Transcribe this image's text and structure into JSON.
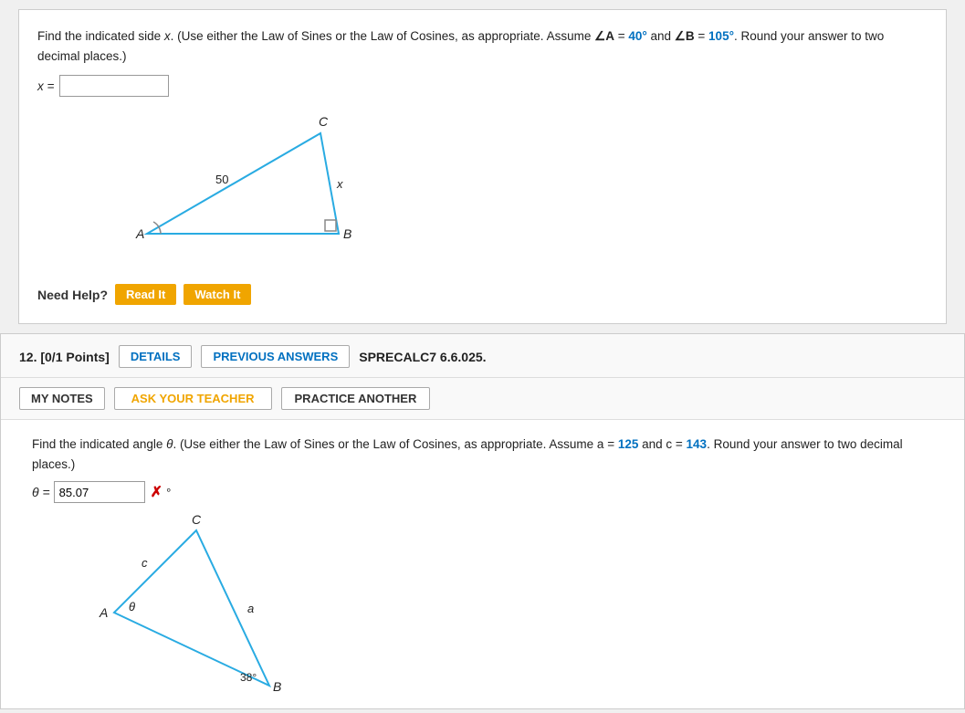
{
  "problem11": {
    "text_part1": "Find the indicated side ",
    "variable_x": "x",
    "text_part2": ". (Use either the Law of Sines or the Law of Cosines, as appropriate. Assume ",
    "angle_a_label": "∠A",
    "angle_a_val": "40°",
    "text_and": " and ",
    "angle_b_label": "∠B",
    "angle_b_val": "105°",
    "text_part3": ". Round your answer to two decimal places.)",
    "answer_label": "x =",
    "answer_placeholder": "",
    "answer_value": "",
    "need_help_label": "Need Help?",
    "btn_read_it": "Read It",
    "btn_watch_it": "Watch It",
    "triangle": {
      "side_50": "50",
      "label_x": "x",
      "label_A": "A",
      "label_B": "B",
      "label_C": "C"
    }
  },
  "problem12": {
    "number": "12.",
    "points": "[0/1 Points]",
    "btn_details": "DETAILS",
    "btn_previous": "PREVIOUS ANSWERS",
    "problem_code": "SPRECALC7 6.6.025.",
    "btn_my_notes": "MY NOTES",
    "btn_ask_teacher": "ASK YOUR TEACHER",
    "btn_practice": "PRACTICE ANOTHER",
    "text_part1": "Find the indicated angle ",
    "theta_sym": "θ",
    "text_part2": ". (Use either the Law of Sines or the Law of Cosines, as appropriate. Assume a",
    "a_val": "125",
    "text_and": " and c",
    "c_val": "143",
    "text_part3": ". Round your answer to two decimal places.)",
    "answer_label": "θ =",
    "answer_value": "85.07",
    "degree_sym": "°",
    "triangle": {
      "label_A": "A",
      "label_B": "B",
      "label_C": "C",
      "label_theta": "θ",
      "label_a": "a",
      "label_c": "c",
      "angle_38": "38°"
    }
  }
}
